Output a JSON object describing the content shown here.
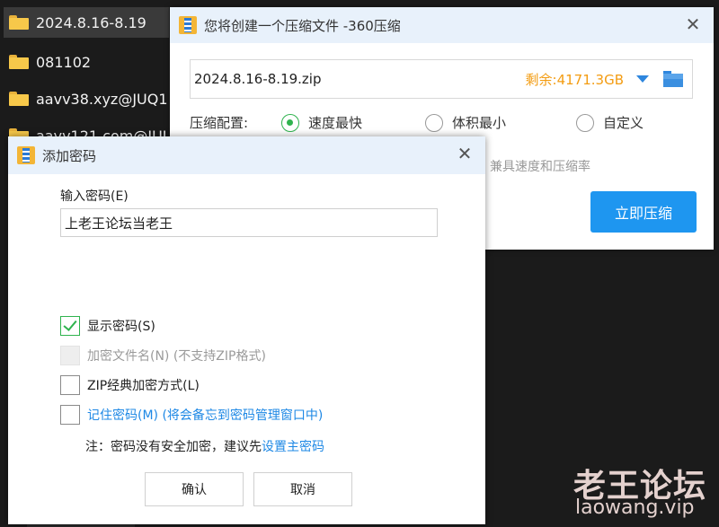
{
  "explorer": {
    "items": [
      {
        "name": "2024.8.16-8.19",
        "selected": true
      },
      {
        "name": "081102",
        "selected": false
      },
      {
        "name": "aavv38.xyz@JUQ1",
        "selected": false
      },
      {
        "name": "aavv121.com@JUL",
        "selected": false
      }
    ]
  },
  "compress_window": {
    "title": "您将创建一个压缩文件 -360压缩",
    "close_icon": "close-icon",
    "filename": "2024.8.16-8.19.zip",
    "free_space": "剩余:4171.3GB",
    "config_label": "压缩配置:",
    "options": [
      {
        "label": "速度最快",
        "checked": true
      },
      {
        "label": "体积最小",
        "checked": false
      },
      {
        "label": "自定义",
        "checked": false
      }
    ],
    "hint": "兼具速度和压缩率",
    "compress_button": "立即压缩",
    "accent_color": "#1e96f0",
    "free_space_color": "#f39c12"
  },
  "password_dialog": {
    "title": "添加密码",
    "input_label": "输入密码(E)",
    "password_value": "上老王论坛当老王",
    "checkboxes": [
      {
        "label": "显示密码(S)",
        "checked": true,
        "disabled": false
      },
      {
        "label": "加密文件名(N) (不支持ZIP格式)",
        "checked": false,
        "disabled": true
      },
      {
        "label": "ZIP经典加密方式(L)",
        "checked": false,
        "disabled": false
      },
      {
        "label": "记住密码(M) (将会备忘到密码管理窗口中)",
        "checked": false,
        "disabled": false
      }
    ],
    "note_prefix": "注：密码没有安全加密，建议先",
    "note_link": "设置主密码",
    "ok_button": "确认",
    "cancel_button": "取消",
    "check_color": "#2fb34e"
  },
  "watermark": {
    "line1": "老王论坛",
    "line2": "laowang.vip"
  }
}
